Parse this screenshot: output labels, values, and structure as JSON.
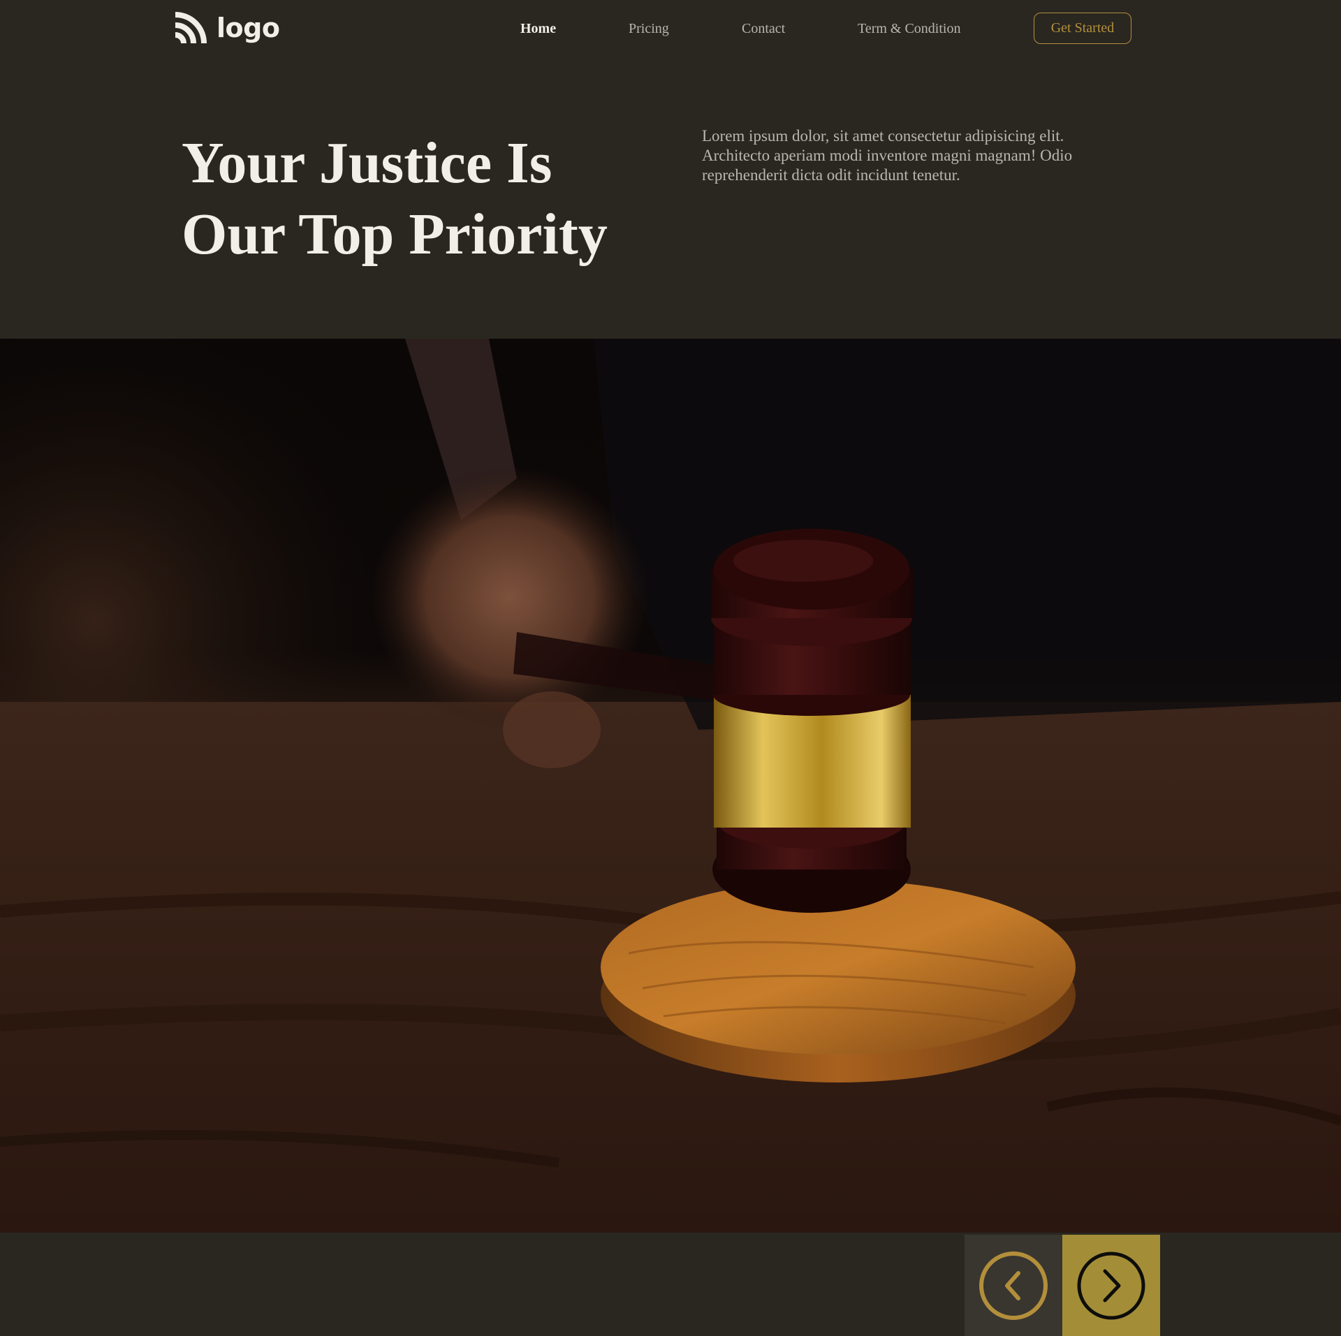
{
  "nav": {
    "logo_text": "logo",
    "links": [
      {
        "label": "Home",
        "active": true
      },
      {
        "label": "Pricing",
        "active": false
      },
      {
        "label": "Contact",
        "active": false
      },
      {
        "label": "Term & Condition",
        "active": false
      }
    ],
    "cta_label": "Get Started"
  },
  "hero": {
    "title_line1": "Your Justice Is",
    "title_line2": "Our Top Priority",
    "description": "Lorem ipsum dolor, sit amet consectetur adipisicing elit. Architecto aperiam modi inventore magni magnam! Odio reprehenderit dicta odit incidunt tenetur."
  },
  "slider": {
    "prev_icon": "chevron-left-circle-icon",
    "next_icon": "chevron-right-circle-icon"
  },
  "colors": {
    "background": "#2a2721",
    "accent": "#b38f3b",
    "next_button": "#a38e37",
    "prev_button": "#393630",
    "text_light": "#f2efe9",
    "text_muted": "#b9b6b0"
  }
}
